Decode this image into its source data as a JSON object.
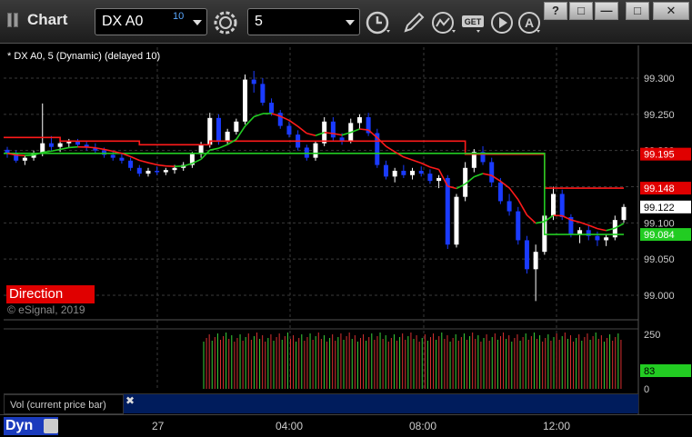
{
  "app": {
    "title": "Chart"
  },
  "toolbar": {
    "symbol": "DX A0",
    "delay_badge": "10",
    "interval": "5",
    "icons": [
      "gear-icon",
      "clock-icon",
      "pencil-icon",
      "study-icon",
      "get-icon",
      "play-icon",
      "alert-icon"
    ]
  },
  "window_controls": [
    "help-icon",
    "restore-icon",
    "minimize-icon",
    "maximize-icon",
    "close-icon"
  ],
  "chart": {
    "title": "* DX A0, 5 (Dynamic) (delayed 10)",
    "direction_label": "Direction",
    "watermark": "© eSignal, 2019",
    "price_ticks": [
      "99.300",
      "99.250",
      "99.200",
      "99.150",
      "99.100",
      "99.050",
      "99.000"
    ],
    "price_badges": [
      {
        "text": "99.195",
        "color": "#e00000"
      },
      {
        "text": "99.148",
        "color": "#e00000"
      },
      {
        "text": "99.122",
        "color": "#ffffff"
      },
      {
        "text": "99.084",
        "color": "#22cc22"
      }
    ],
    "vol_ticks": [
      "250",
      "0"
    ],
    "vol_badge": "83",
    "time_labels": [
      "27",
      "04:00",
      "08:00",
      "12:00"
    ],
    "colors": {
      "up": "#ffffff",
      "down": "#1a3bff",
      "red_line": "#ff1a1a",
      "green_line": "#22cc22",
      "vol_up": "#3ad23a",
      "vol_down": "#d83030"
    }
  },
  "volume_panel": {
    "label": "Vol (current price bar)"
  },
  "status": {
    "mode": "Dyn"
  },
  "chart_data": {
    "type": "candlestick",
    "title": "* DX A0, 5 (Dynamic) (delayed 10)",
    "ylim": [
      98.99,
      99.31
    ],
    "x_labels": [
      "27",
      "04:00",
      "08:00",
      "12:00"
    ],
    "series": [
      {
        "values": [
          [
            99.201,
            99.205,
            99.19,
            99.196
          ],
          [
            99.196,
            99.2,
            99.183,
            99.186
          ],
          [
            99.186,
            99.194,
            99.18,
            99.19
          ],
          [
            99.19,
            99.2,
            99.186,
            99.197
          ],
          [
            99.197,
            99.265,
            99.192,
            99.21
          ],
          [
            99.21,
            99.22,
            99.2,
            99.205
          ],
          [
            99.205,
            99.212,
            99.198,
            99.21
          ],
          [
            99.21,
            99.216,
            99.204,
            99.213
          ],
          [
            99.213,
            99.216,
            99.206,
            99.208
          ],
          [
            99.208,
            99.212,
            99.2,
            99.204
          ],
          [
            99.204,
            99.21,
            99.196,
            99.2
          ],
          [
            99.2,
            99.204,
            99.19,
            99.194
          ],
          [
            99.194,
            99.2,
            99.186,
            99.19
          ],
          [
            99.19,
            99.196,
            99.182,
            99.186
          ],
          [
            99.186,
            99.19,
            99.172,
            99.176
          ],
          [
            99.176,
            99.18,
            99.164,
            99.168
          ],
          [
            99.168,
            99.176,
            99.164,
            99.172
          ],
          [
            99.172,
            99.178,
            99.166,
            99.17
          ],
          [
            99.17,
            99.176,
            99.166,
            99.173
          ],
          [
            99.173,
            99.18,
            99.168,
            99.176
          ],
          [
            99.176,
            99.184,
            99.172,
            99.18
          ],
          [
            99.18,
            99.198,
            99.176,
            99.195
          ],
          [
            99.195,
            99.212,
            99.19,
            99.208
          ],
          [
            99.208,
            99.252,
            99.204,
            99.245
          ],
          [
            99.245,
            99.25,
            99.208,
            99.212
          ],
          [
            99.212,
            99.23,
            99.208,
            99.226
          ],
          [
            99.226,
            99.244,
            99.222,
            99.24
          ],
          [
            99.24,
            99.305,
            99.236,
            99.298
          ],
          [
            99.298,
            99.31,
            99.28,
            99.292
          ],
          [
            99.292,
            99.3,
            99.262,
            99.266
          ],
          [
            99.266,
            99.272,
            99.248,
            99.252
          ],
          [
            99.252,
            99.256,
            99.23,
            99.234
          ],
          [
            99.234,
            99.24,
            99.218,
            99.222
          ],
          [
            99.222,
            99.228,
            99.2,
            99.204
          ],
          [
            99.204,
            99.208,
            99.186,
            99.19
          ],
          [
            99.19,
            99.214,
            99.186,
            99.21
          ],
          [
            99.21,
            99.246,
            99.206,
            99.24
          ],
          [
            99.24,
            99.246,
            99.214,
            99.218
          ],
          [
            99.218,
            99.224,
            99.208,
            99.214
          ],
          [
            99.214,
            99.244,
            99.21,
            99.238
          ],
          [
            99.238,
            99.25,
            99.23,
            99.246
          ],
          [
            99.246,
            99.252,
            99.22,
            99.224
          ],
          [
            99.224,
            99.23,
            99.176,
            99.18
          ],
          [
            99.18,
            99.186,
            99.16,
            99.164
          ],
          [
            99.164,
            99.176,
            99.156,
            99.172
          ],
          [
            99.172,
            99.18,
            99.162,
            99.166
          ],
          [
            99.166,
            99.176,
            99.16,
            99.172
          ],
          [
            99.172,
            99.178,
            99.164,
            99.168
          ],
          [
            99.168,
            99.174,
            99.154,
            99.158
          ],
          [
            99.158,
            99.166,
            99.148,
            99.162
          ],
          [
            99.162,
            99.166,
            99.064,
            99.07
          ],
          [
            99.07,
            99.14,
            99.066,
            99.136
          ],
          [
            99.136,
            99.184,
            99.13,
            99.176
          ],
          [
            99.176,
            99.202,
            99.17,
            99.198
          ],
          [
            99.198,
            99.206,
            99.18,
            99.184
          ],
          [
            99.184,
            99.19,
            99.15,
            99.156
          ],
          [
            99.156,
            99.162,
            99.126,
            99.13
          ],
          [
            99.13,
            99.14,
            99.11,
            99.116
          ],
          [
            99.116,
            99.122,
            99.07,
            99.076
          ],
          [
            99.076,
            99.082,
            99.03,
            99.036
          ],
          [
            99.036,
            99.07,
            98.992,
            99.06
          ],
          [
            99.06,
            99.12,
            99.056,
            99.11
          ],
          [
            99.11,
            99.15,
            99.104,
            99.14
          ],
          [
            99.14,
            99.146,
            99.104,
            99.108
          ],
          [
            99.108,
            99.112,
            99.08,
            99.084
          ],
          [
            99.084,
            99.094,
            99.072,
            99.09
          ],
          [
            99.09,
            99.096,
            99.076,
            99.082
          ],
          [
            99.082,
            99.088,
            99.068,
            99.076
          ],
          [
            99.076,
            99.084,
            99.068,
            99.08
          ],
          [
            99.08,
            99.11,
            99.076,
            99.104
          ],
          [
            99.104,
            99.126,
            99.1,
            99.122
          ]
        ]
      },
      {
        "name": "red",
        "values": [
          99.218,
          99.218,
          99.218,
          99.218,
          99.218,
          99.218,
          99.213,
          99.213,
          99.213,
          99.213,
          99.213,
          99.213,
          99.213,
          99.213,
          99.213,
          99.208,
          99.208,
          99.208,
          99.208,
          99.208,
          99.208,
          99.208,
          99.208,
          99.213,
          99.213,
          99.213,
          99.213,
          99.213,
          99.213,
          99.213,
          99.213,
          99.213,
          99.213,
          99.213,
          99.213,
          99.213,
          99.213,
          99.213,
          99.213,
          99.213,
          99.213,
          99.213,
          99.213,
          99.213,
          99.213,
          99.213,
          99.213,
          99.213,
          99.213,
          99.213,
          99.213,
          99.213,
          99.195,
          99.195,
          99.195,
          99.195,
          99.195,
          99.195,
          99.195,
          99.195,
          99.195,
          99.148,
          99.148,
          99.148,
          99.148,
          99.148,
          99.148,
          99.148,
          99.148,
          99.148,
          99.148
        ]
      },
      {
        "name": "green",
        "values": [
          99.196,
          99.196,
          99.196,
          99.196,
          99.196,
          99.196,
          99.196,
          99.196,
          99.196,
          99.196,
          99.196,
          99.196,
          99.196,
          99.196,
          99.196,
          99.196,
          99.196,
          99.196,
          99.196,
          99.196,
          99.196,
          99.196,
          99.196,
          99.196,
          99.196,
          99.196,
          99.196,
          99.196,
          99.196,
          99.196,
          99.196,
          99.196,
          99.196,
          99.196,
          99.196,
          99.196,
          99.196,
          99.196,
          99.196,
          99.196,
          99.196,
          99.196,
          99.196,
          99.196,
          99.196,
          99.196,
          99.196,
          99.196,
          99.196,
          99.196,
          99.196,
          99.196,
          99.196,
          99.196,
          99.196,
          99.196,
          99.196,
          99.196,
          99.196,
          99.196,
          99.196,
          99.084,
          99.084,
          99.084,
          99.084,
          99.084,
          99.084,
          99.084,
          99.084,
          99.084,
          99.084
        ]
      }
    ]
  }
}
